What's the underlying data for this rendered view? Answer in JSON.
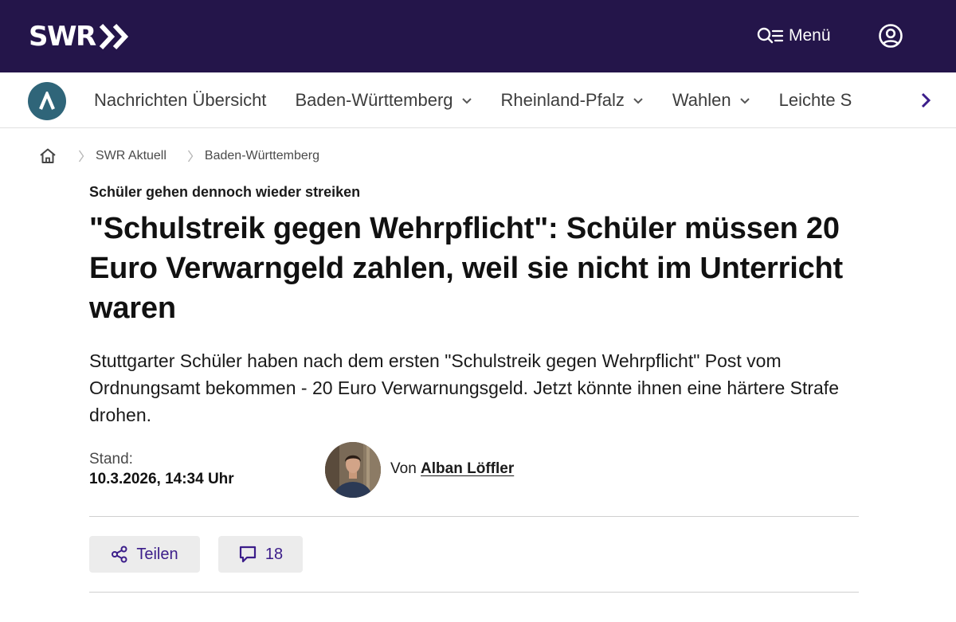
{
  "colors": {
    "header_bg": "#24154a",
    "accent": "#3b1d8a",
    "nav_badge": "#2f6579",
    "button_bg": "#ececec"
  },
  "header": {
    "logo_text": "SWR",
    "logo_icon": "double-chevron-icon",
    "menu_label": "Menü",
    "menu_icon": "search-menu-icon",
    "account_icon": "user-icon"
  },
  "nav": {
    "badge_icon": "lambda-logo-icon",
    "items": [
      {
        "label": "Nachrichten Übersicht",
        "has_dropdown": false
      },
      {
        "label": "Baden-Württemberg",
        "has_dropdown": true
      },
      {
        "label": "Rheinland-Pfalz",
        "has_dropdown": true
      },
      {
        "label": "Wahlen",
        "has_dropdown": true
      },
      {
        "label": "Leichte S",
        "has_dropdown": false
      }
    ],
    "next_icon": "chevron-right-icon"
  },
  "breadcrumb": {
    "home_icon": "home-icon",
    "items": [
      "SWR Aktuell",
      "Baden-Württemberg"
    ]
  },
  "article": {
    "kicker": "Schüler gehen dennoch wieder streiken",
    "headline": "\"Schulstreik gegen Wehrpflicht\": Schüler müssen 20 Euro Verwarngeld zahlen, weil sie nicht im Unterricht waren",
    "teaser": "Stuttgarter Schüler haben nach dem ersten \"Schulstreik gegen Wehrpflicht\" Post vom Ordnungsamt bekommen - 20 Euro Verwarnungsgeld. Jetzt könnte ihnen eine härtere Strafe drohen.",
    "stand_label": "Stand:",
    "stand_date": "10.3.2026, 14:34 Uhr",
    "author_prefix": "Von",
    "author_name": "Alban Löffler"
  },
  "actions": {
    "share_label": "Teilen",
    "share_icon": "share-icon",
    "comments_count": "18",
    "comments_icon": "comment-icon"
  }
}
